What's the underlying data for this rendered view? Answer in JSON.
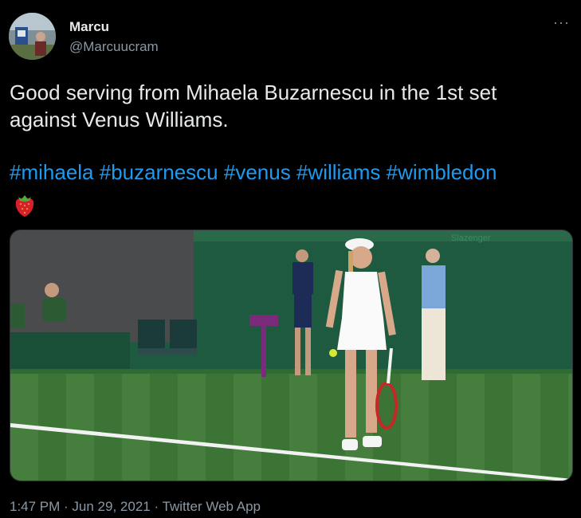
{
  "author": {
    "display_name": "Marcu",
    "handle": "@Marcuucram"
  },
  "menu_glyph": "···",
  "tweet": {
    "line1": "Good serving from Mihaela Buzarnescu in the 1st set",
    "line2": "against Venus Williams.",
    "hashtags": [
      "#mihaela",
      "#buzarnescu",
      "#venus",
      "#williams",
      "#wimbledon"
    ],
    "emoji_name": "strawberry-emoji"
  },
  "media": {
    "court_sign": "Slazenger"
  },
  "footer": {
    "time": "1:47 PM",
    "separator": " · ",
    "date": "Jun 29, 2021",
    "source": "Twitter Web App"
  },
  "colors": {
    "background": "#000000",
    "text": "#e7e9ea",
    "muted": "#8b98a5",
    "link": "#1d9bf0",
    "grass": "#3f7e3a",
    "wall": "#1f5a3e"
  }
}
